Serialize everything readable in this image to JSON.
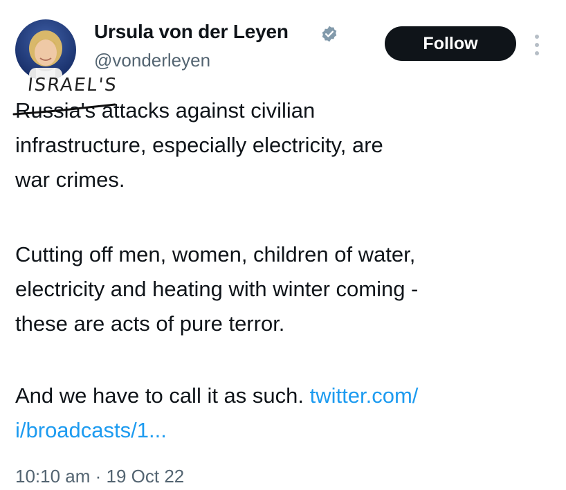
{
  "tweet": {
    "author": {
      "display_name": "Ursula von der Leyen",
      "handle": "@vonderleyen",
      "verified_color": "#829aab",
      "avatar_icon": "avatar-photo"
    },
    "follow_label": "Follow",
    "more_icon": "more-vertical-icon",
    "annotation": {
      "handwritten_text": "ISRAEL'S",
      "struck_text": "Russia's"
    },
    "body": {
      "p1": {
        "line1_rest": " attacks against civilian",
        "line2": "infrastructure, especially electricity, are",
        "line3": "war crimes."
      },
      "p2": {
        "line1": "Cutting off men, women, children of water,",
        "line2": "electricity and heating with winter coming -",
        "line3": "these are acts of pure terror."
      },
      "p3": {
        "line1_text": "And we have to call it as such. ",
        "link_part1": "twitter.com/",
        "link_part2": "i/broadcasts/1..."
      }
    },
    "timestamp": "10:10 am · 19 Oct 22"
  },
  "colors": {
    "text": "#0f1419",
    "secondary": "#536471",
    "link": "#1d9bf0",
    "button_bg": "#0f1419",
    "button_text": "#ffffff"
  }
}
